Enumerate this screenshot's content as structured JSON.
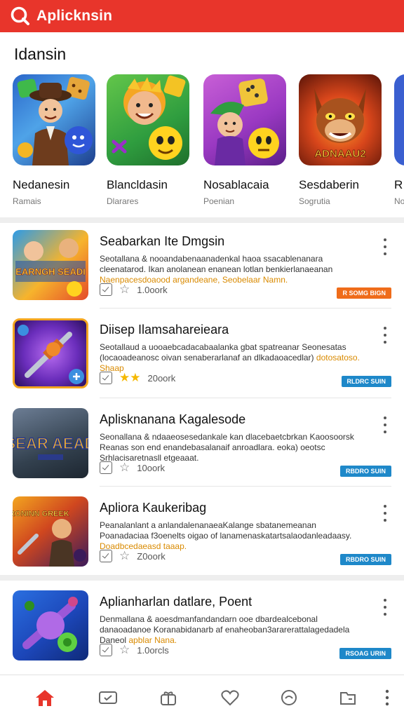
{
  "app_bar": {
    "title": "Aplicknsin",
    "color": "#e8352b",
    "logo_icon": "search-logo-icon"
  },
  "featured_section": {
    "title": "Idansin",
    "items": [
      {
        "name": "Nedanesin",
        "subtitle": "Ramais"
      },
      {
        "name": "Blancldasin",
        "subtitle": "Dlarares"
      },
      {
        "name": "Nosablacaia",
        "subtitle": "Poenian"
      },
      {
        "name": "Sesdaberin",
        "subtitle": "Sogrutia",
        "art_text": "ADNAAU2"
      },
      {
        "name": "R",
        "subtitle": "No"
      }
    ]
  },
  "list": [
    {
      "title": "Seabarkan Ite Dmgsin",
      "desc": "Seotallana & nooandabenaanadenkal haoa ssacablenanara cleenatarod. Ikan anolanean enanean lotlan benkierlanaeanan",
      "desc_highlight": "Naenpacesdoaood argandeane, Seobelaar Namn.",
      "thumb_text": "EARNGH SEADI",
      "count": "1.0oork",
      "rating_stars": 0,
      "badge": "R SOMG BIGN",
      "badge_color": "#ef6c1a"
    },
    {
      "title": "Diisep Ilamsahareieara",
      "desc": "Seotallaud a uooaebcadacabaalanka gbat spatreanar Seonesatas (locaoadeanosc oivan senaberarlanaf an dlkadaoacedlar)",
      "desc_highlight": "dotosatoso. Shaap",
      "thumb_text": "",
      "count": "20oork",
      "rating_stars": 2,
      "badge": "RLDRC SUIN",
      "badge_color": "#1e88c9"
    },
    {
      "title": "Aplisknanana Kagalesode",
      "desc": "Seonallana & ndaaeosesedankale kan dlacebaetcbrkan Kaoosoorsk Reanas son end enandebasalanaif anroadlara. eoka) oeotsc Srhlacisaretnasll etgeaaat.",
      "desc_highlight": "",
      "thumb_text": "SEAR AEAD",
      "count": "10oork",
      "rating_stars": 0,
      "badge": "RBDRO SUIN",
      "badge_color": "#1e88c9"
    },
    {
      "title": "Apliora Kaukeribag",
      "desc": "Peanalanlant a anlandalenanaeaKalange sbatanemeanan Poanadaciaa f3oenelts oigao of lanamenaskatartsalaodanleadaasy.",
      "desc_highlight": "Doadbcedaeasd taaap.",
      "thumb_text": "CRONINN GREEK",
      "count": "Z0oork",
      "rating_stars": 0,
      "badge": "RBDRO SUIN",
      "badge_color": "#1e88c9"
    },
    {
      "title": "Aplianharlan datlare, Poent",
      "desc": "Denmallana & aoesdmanfandandarn ooe dbardealcebonal danaoadanoe Koranabidanarb af enaheoban3ararerattalagedadela Daneol",
      "desc_highlight": "apblar Nana.",
      "thumb_text": "",
      "count": "1.0orcls",
      "rating_stars": 0,
      "badge": "RSOAG URIN",
      "badge_color": "#1e88c9"
    }
  ],
  "bottom_nav": {
    "items": [
      "home-icon",
      "ticket-icon",
      "gift-icon",
      "heart-icon",
      "chat-icon",
      "folder-icon",
      "more-icon"
    ],
    "active_color": "#e8352b"
  }
}
